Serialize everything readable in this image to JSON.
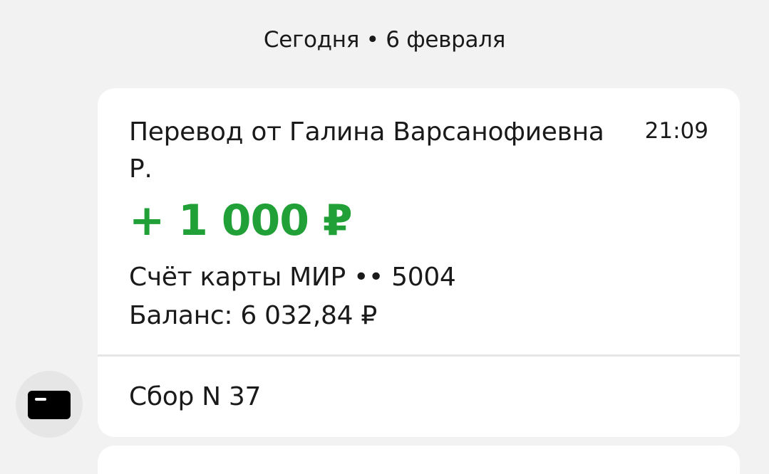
{
  "date_header": "Сегодня • 6 февраля",
  "message": {
    "sender": "Перевод от Галина Варсанофиевна Р.",
    "time": "21:09",
    "amount": "+ 1 000 ₽",
    "account": "Счёт карты МИР •• 5004",
    "balance": "Баланс: 6 032,84 ₽",
    "comment": "Сбор N 37"
  },
  "avatar": {
    "icon": "card-icon"
  },
  "colors": {
    "background": "#f2f2f2",
    "card": "#ffffff",
    "amount_green": "#21a038",
    "avatar_bg": "#e6e6e6"
  }
}
